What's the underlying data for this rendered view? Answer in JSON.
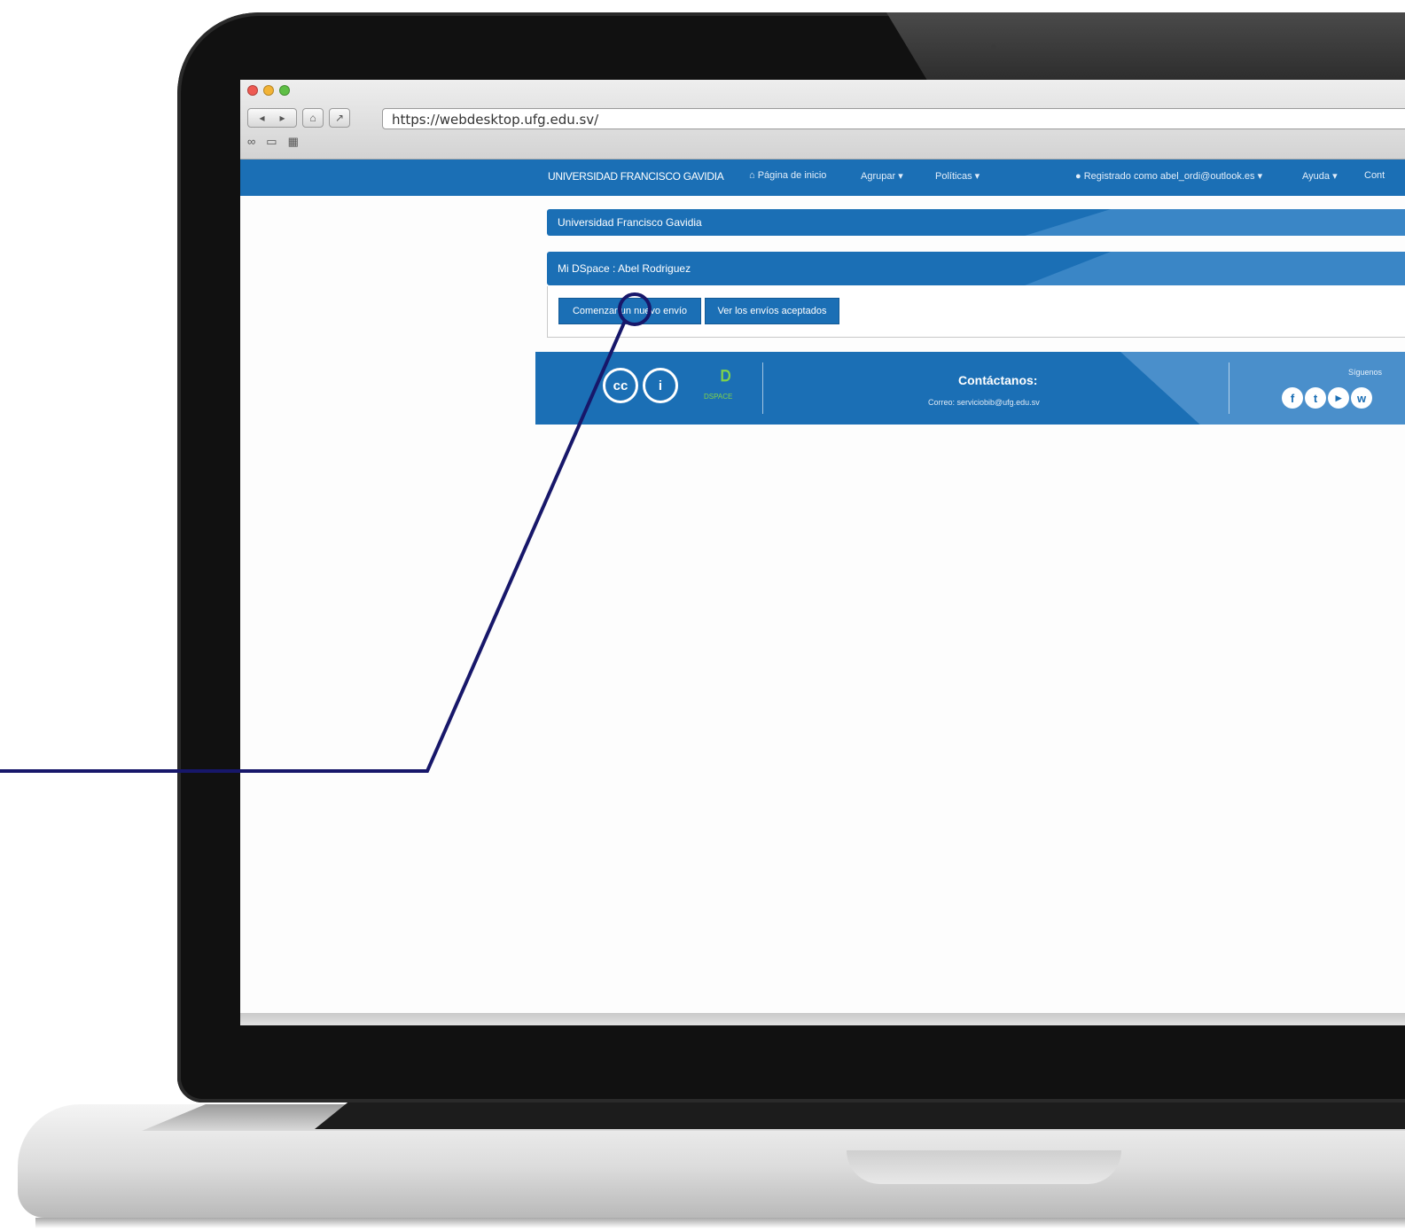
{
  "browser": {
    "url": "https://webdesktop.ufg.edu.sv/"
  },
  "navbar": {
    "brand": "UNIVERSIDAD FRANCISCO GAVIDIA",
    "home": "Página de inicio",
    "browse": "Agrupar",
    "policies": "Políticas",
    "user": "Registrado como abel_ordi@outlook.es",
    "help": "Ayuda",
    "contact": "Cont"
  },
  "breadcrumb": {
    "title": "Universidad Francisco Gavidia"
  },
  "mydspace": {
    "heading": "Mi DSpace : Abel Rodriguez",
    "buttons": {
      "new_submission": "Comenzar un nuevo envío",
      "accepted_submissions": "Ver los envíos aceptados"
    }
  },
  "footer": {
    "cc_label": "cc",
    "dspace_label": "DSPACE",
    "contact_title": "Contáctanos:",
    "contact_email": "Correo: serviciobib@ufg.edu.sv",
    "follow_label": "Síguenos"
  },
  "colors": {
    "brand_blue": "#1b6fb5",
    "callout_line": "#17176a"
  },
  "icons": {
    "home": "home-icon",
    "user": "user-icon",
    "cc": "creative-commons-icon",
    "attribution": "attribution-icon",
    "dspace": "dspace-logo",
    "social": [
      "facebook-icon",
      "twitter-icon",
      "youtube-icon",
      "whatsapp-icon"
    ]
  }
}
